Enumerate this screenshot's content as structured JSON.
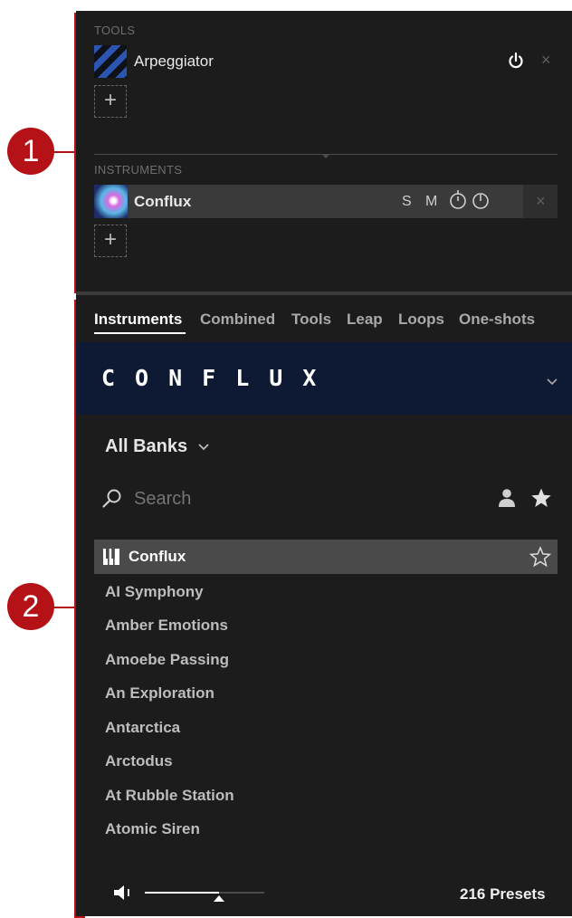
{
  "callouts": [
    "1",
    "2"
  ],
  "tools": {
    "label": "TOOLS",
    "slots": [
      {
        "name": "Arpeggiator",
        "icon": "arpeggiator-thumbnail"
      }
    ],
    "add_label": "+",
    "power_icon": "power-icon",
    "close_label": "×"
  },
  "instruments": {
    "label": "INSTRUMENTS",
    "slots": [
      {
        "name": "Conflux",
        "solo": "S",
        "mute": "M",
        "icon": "conflux-thumbnail"
      }
    ],
    "add_label": "+",
    "close_label": "×"
  },
  "browser": {
    "tabs": [
      {
        "label": "Instruments",
        "active": true
      },
      {
        "label": "Combined"
      },
      {
        "label": "Tools"
      },
      {
        "label": "Leap"
      },
      {
        "label": "Loops"
      },
      {
        "label": "One-shots"
      }
    ],
    "banner_title": "CONFLUX",
    "banks_label": "All Banks",
    "search_placeholder": "Search",
    "selected_preset": "Conflux",
    "presets": [
      "AI Symphony",
      "Amber Emotions",
      "Amoebe Passing",
      "An Exploration",
      "Antarctica",
      "Arctodus",
      "At Rubble Station",
      "Atomic Siren"
    ],
    "preset_count": "216 Presets",
    "volume": 0.62
  },
  "colors": {
    "accent_red": "#b51217",
    "banner_bg": "#0e1a33",
    "panel_bg": "#1c1c1c",
    "selected_row_bg": "#4a4a4a"
  }
}
